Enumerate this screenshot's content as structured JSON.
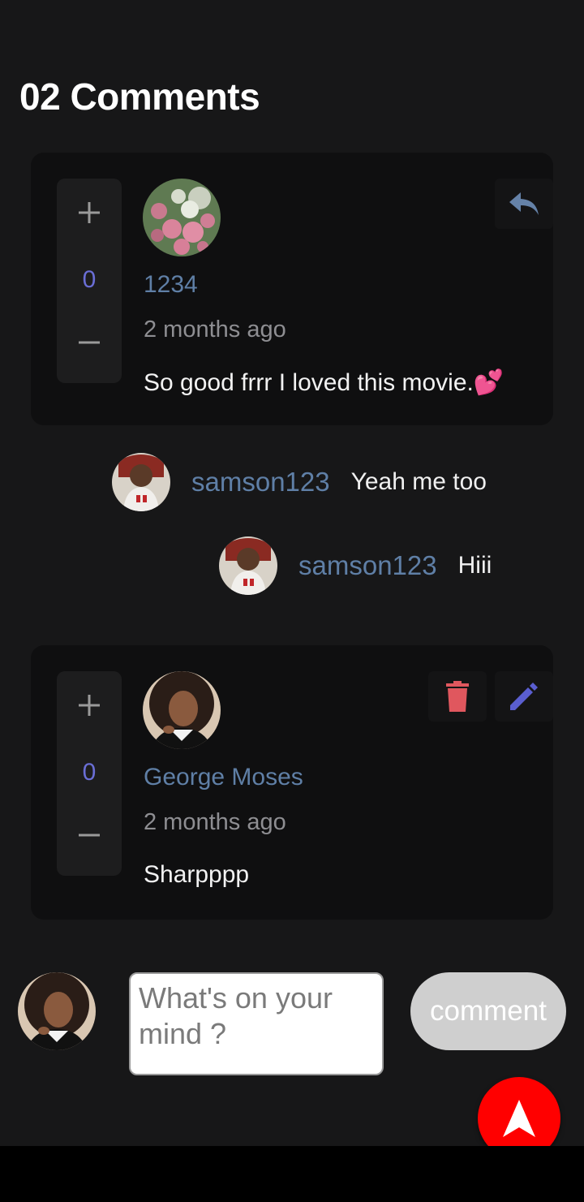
{
  "header": {
    "title": "02 Comments"
  },
  "colors": {
    "accent": "#6a6ed6",
    "username": "#5f7fa6",
    "delete": "#e0575e",
    "fab": "#ff0000"
  },
  "comments": [
    {
      "votes": "0",
      "username": "1234",
      "time": "2 months ago",
      "text": "So good frrr I loved this movie.💕",
      "avatar": "flowers-avatar",
      "actions": [
        "reply-icon"
      ],
      "replies": [
        {
          "username": "samson123",
          "text": "Yeah me too",
          "avatar": "child-avatar"
        },
        {
          "username": "samson123",
          "text": "Hiii",
          "avatar": "child-avatar"
        }
      ]
    },
    {
      "votes": "0",
      "username": "George Moses",
      "time": "2 months ago",
      "text": "Sharpppp",
      "avatar": "woman-avatar",
      "actions": [
        "delete-icon",
        "edit-icon"
      ]
    }
  ],
  "composer": {
    "placeholder": "What's on your mind ?",
    "button_label": "comment",
    "avatar": "woman-avatar"
  },
  "fab": {
    "icon": "navigation-arrow-icon"
  }
}
